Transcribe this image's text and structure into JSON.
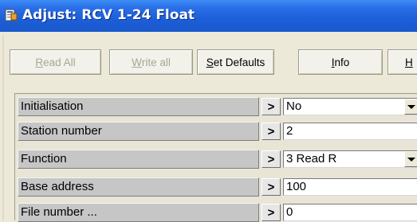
{
  "window": {
    "title": "Adjust: RCV 1-24 Float"
  },
  "toolbar": {
    "read_all": {
      "pre": "",
      "ul": "R",
      "post": "ead All"
    },
    "write_all": {
      "pre": "",
      "ul": "W",
      "post": "rite all"
    },
    "set_defaults": {
      "pre": "",
      "ul": "S",
      "post": "et Defaults"
    },
    "info": {
      "pre": "",
      "ul": "I",
      "post": "nfo"
    },
    "help": {
      "pre": "",
      "ul": "H",
      "post": ""
    }
  },
  "rows": [
    {
      "label": "Initialisation",
      "arrow": ">",
      "value": "No"
    },
    {
      "label": "Station number",
      "arrow": ">",
      "value": "2"
    },
    {
      "label": "Function",
      "arrow": ">",
      "value": "3 Read R"
    },
    {
      "label": "Base address",
      "arrow": ">",
      "value": "100"
    },
    {
      "label": "File number ...",
      "arrow": ">",
      "value": "0"
    }
  ]
}
